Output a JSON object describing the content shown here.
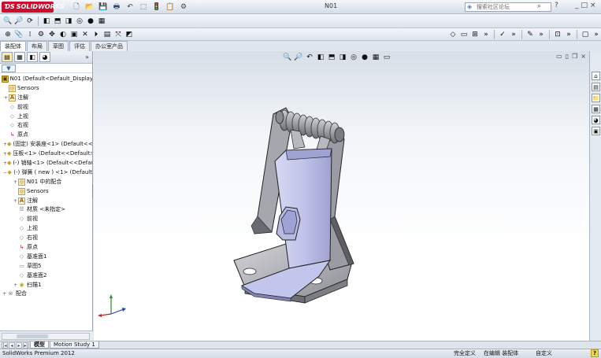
{
  "window": {
    "app_logo": "SOLIDWORKS",
    "doc_title": "N01",
    "search_placeholder": "搜索社区论坛",
    "help_label": "?",
    "win_min": "_",
    "win_max": "□",
    "win_close": "×"
  },
  "command_tabs": [
    "装配体",
    "布局",
    "草图",
    "评估",
    "办公室产品"
  ],
  "panel": {
    "expand_label": "»",
    "filter_label": "▼"
  },
  "tree": [
    {
      "level": 0,
      "exp": "",
      "icon": "asm",
      "label": "N01  (Default<Default_Display S"
    },
    {
      "level": 1,
      "exp": "",
      "icon": "sensor",
      "label": "Sensors"
    },
    {
      "level": 1,
      "exp": "+",
      "icon": "anno",
      "label": "注解"
    },
    {
      "level": 1,
      "exp": "",
      "icon": "plane",
      "label": "前视"
    },
    {
      "level": 1,
      "exp": "",
      "icon": "plane",
      "label": "上视"
    },
    {
      "level": 1,
      "exp": "",
      "icon": "plane",
      "label": "右视"
    },
    {
      "level": 1,
      "exp": "",
      "icon": "origin",
      "label": "原点"
    },
    {
      "level": 1,
      "exp": "+",
      "icon": "part",
      "label": "(固定) 安装座<1> (Default<<"
    },
    {
      "level": 1,
      "exp": "+",
      "icon": "part",
      "label": "压板<1> (Default<<Default>"
    },
    {
      "level": 1,
      "exp": "+",
      "icon": "part",
      "label": "(-) 销轴<1> (Default<<Defau"
    },
    {
      "level": 1,
      "exp": "−",
      "icon": "part",
      "label": "(-) 弹簧 ( new ) <1> (Default"
    },
    {
      "level": 2,
      "exp": "+",
      "icon": "sensor",
      "label": "N01 中的配合"
    },
    {
      "level": 2,
      "exp": "",
      "icon": "sensor",
      "label": "Sensors"
    },
    {
      "level": 2,
      "exp": "+",
      "icon": "anno",
      "label": "注解"
    },
    {
      "level": 2,
      "exp": "",
      "icon": "material",
      "label": "材质 <未指定>"
    },
    {
      "level": 2,
      "exp": "",
      "icon": "plane",
      "label": "前视"
    },
    {
      "level": 2,
      "exp": "",
      "icon": "plane",
      "label": "上视"
    },
    {
      "level": 2,
      "exp": "",
      "icon": "plane",
      "label": "右视"
    },
    {
      "level": 2,
      "exp": "",
      "icon": "origin",
      "label": "原点"
    },
    {
      "level": 2,
      "exp": "",
      "icon": "plane",
      "label": "基准面1"
    },
    {
      "level": 2,
      "exp": "",
      "icon": "sketch",
      "label": "草图5"
    },
    {
      "level": 2,
      "exp": "",
      "icon": "plane",
      "label": "基准面2"
    },
    {
      "level": 2,
      "exp": "+",
      "icon": "sweep",
      "label": "扫描1"
    },
    {
      "level": 0,
      "exp": "+",
      "icon": "mates",
      "label": "配合"
    }
  ],
  "bottom_tabs": [
    "模型",
    "Motion Study 1"
  ],
  "status": {
    "product": "SolidWorks Premium 2012",
    "definition": "完全定义",
    "editing": "在编辑 装配体",
    "custom": "自定义",
    "help": "?"
  }
}
